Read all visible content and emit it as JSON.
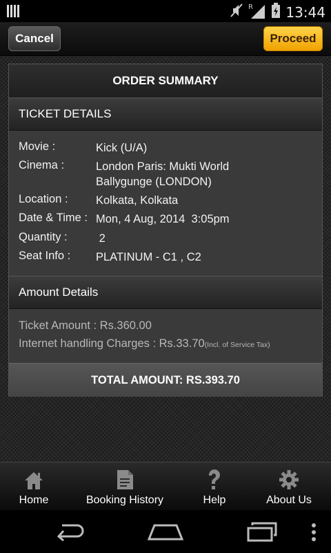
{
  "status_bar": {
    "time": "13:44",
    "icons": [
      "signal-bars-icon",
      "mute-icon",
      "roaming-r-icon",
      "cell-signal-icon",
      "battery-icon"
    ]
  },
  "action_bar": {
    "cancel_label": "Cancel",
    "proceed_label": "Proceed"
  },
  "order_summary": {
    "title": "ORDER SUMMARY",
    "ticket_details": {
      "heading": "TICKET DETAILS",
      "rows": [
        {
          "label": "Movie :",
          "value": "Kick (U/A)"
        },
        {
          "label": "Cinema :",
          "value": "London Paris: Mukti World Ballygunge (LONDON)"
        },
        {
          "label": "Location :",
          "value": "Kolkata, Kolkata"
        },
        {
          "label": "Date & Time :",
          "value": "Mon, 4 Aug, 2014  3:05pm"
        },
        {
          "label": "Quantity :",
          "value": " 2"
        },
        {
          "label": "Seat Info :",
          "value": "PLATINUM - C1 , C2"
        }
      ]
    },
    "amount_details": {
      "heading": "Amount Details",
      "ticket_amount": "Ticket Amount : Rs.360.00",
      "internet_charges": "Internet handling Charges : Rs.33.70",
      "internet_charges_note": "(Incl. of Service Tax)"
    },
    "total": "TOTAL AMOUNT: RS.393.70"
  },
  "tabs": [
    {
      "label": "Home",
      "icon": "home-icon"
    },
    {
      "label": "Booking History",
      "icon": "document-icon"
    },
    {
      "label": "Help",
      "icon": "question-icon"
    },
    {
      "label": "About Us",
      "icon": "gear-icon"
    }
  ],
  "nav_bar": {
    "icons": [
      "back-icon",
      "home-outline-icon",
      "recent-apps-icon",
      "overflow-menu-icon"
    ]
  }
}
